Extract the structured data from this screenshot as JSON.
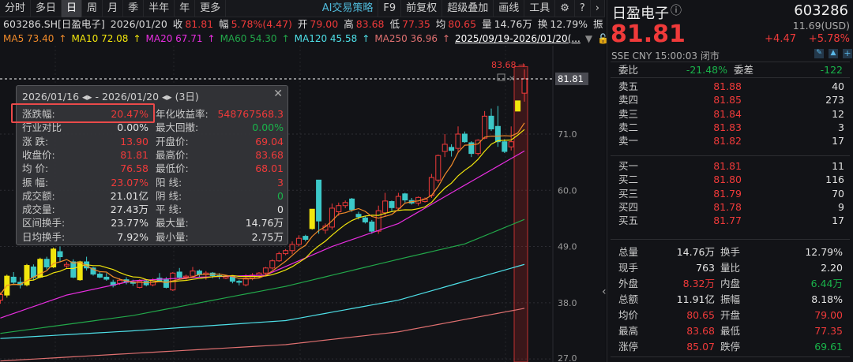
{
  "toolbar": {
    "periods": [
      "分时",
      "多日",
      "日",
      "周",
      "月",
      "季",
      "半年",
      "年",
      "更多"
    ],
    "active": "日",
    "tools": [
      "AI交易策略",
      "F9",
      "前复权",
      "超级叠加",
      "画线",
      "工具"
    ],
    "icons": [
      "gear-icon",
      "help-icon",
      "chevron-right-icon"
    ]
  },
  "info": {
    "code": "603286.SH[日盈电子]",
    "date": "2026/01/20",
    "close_label": "收",
    "close": "81.81",
    "chg_label": "幅",
    "chg": "5.78%(4.47)",
    "open_label": "开",
    "open": "79.00",
    "high_label": "高",
    "high": "83.68",
    "low_label": "低",
    "low": "77.35",
    "avg_label": "均",
    "avg": "80.65",
    "vol_label": "量",
    "vol": "14.76万",
    "turn_label": "换",
    "turn": "12.79%",
    "amp_label": "振"
  },
  "ma_legend": [
    {
      "label": "MA5 73.40",
      "color": "#f08a2a"
    },
    {
      "label": "MA10 72.08",
      "color": "#f2e60c"
    },
    {
      "label": "MA20 67.71",
      "color": "#e82ee0"
    },
    {
      "label": "MA60 54.30",
      "color": "#22a84a"
    },
    {
      "label": "MA120 45.58",
      "color": "#4ee0e8"
    },
    {
      "label": "MA250 36.96",
      "color": "#e07070"
    }
  ],
  "range_label": "2025/09/19-2026/01/20(...",
  "popup": {
    "header": "2026/01/16 ◂▸ - 2026/01/20 ◂▸    (3日)",
    "left": [
      {
        "k": "涨跌幅:",
        "v": "20.47%",
        "c": "red"
      },
      {
        "k": "行业对比",
        "v": "0.00%",
        "c": "wht"
      },
      {
        "k": "涨  跌:",
        "v": "13.90",
        "c": "red"
      },
      {
        "k": "收盘价:",
        "v": "81.81",
        "c": "red"
      },
      {
        "k": "均  价:",
        "v": "76.58",
        "c": "red"
      },
      {
        "k": "振  幅:",
        "v": "23.07%",
        "c": "red"
      },
      {
        "k": "成交额:",
        "v": "21.01亿",
        "c": "wht"
      },
      {
        "k": "成交量:",
        "v": "27.43万",
        "c": "wht"
      },
      {
        "k": "区间换手:",
        "v": "23.77%",
        "c": "wht"
      },
      {
        "k": "日均换手:",
        "v": "7.92%",
        "c": "wht"
      }
    ],
    "right": [
      {
        "k": "年化收益率:",
        "v": "548767568.3",
        "c": "red"
      },
      {
        "k": "最大回撤:",
        "v": "0.00%",
        "c": "grn"
      },
      {
        "k": "开盘价:",
        "v": "69.04",
        "c": "red"
      },
      {
        "k": "最高价:",
        "v": "83.68",
        "c": "red"
      },
      {
        "k": "最低价:",
        "v": "68.01",
        "c": "red"
      },
      {
        "k": "阳  线:",
        "v": "3",
        "c": "red"
      },
      {
        "k": "阴  线:",
        "v": "0",
        "c": "grn"
      },
      {
        "k": "平  线:",
        "v": "0",
        "c": "wht"
      },
      {
        "k": "最大量:",
        "v": "14.76万",
        "c": "wht"
      },
      {
        "k": "最小量:",
        "v": "2.75万",
        "c": "wht"
      }
    ]
  },
  "chart_data": {
    "type": "candlestick",
    "y_ticks": [
      "71.0",
      "60.0",
      "49.0",
      "38.0",
      "27.0"
    ],
    "ylim": [
      27,
      83.7
    ],
    "last_price_label": "81.81",
    "high_marker": "83.68",
    "colors": {
      "up": "#f03a3a",
      "down": "#3cc8c8",
      "limit": "#f2e60c"
    },
    "candles_ohlc": [
      [
        38.5,
        40,
        37.8,
        39.6,
        "u"
      ],
      [
        39.5,
        43.5,
        39,
        43.2,
        "y"
      ],
      [
        43,
        44,
        41.5,
        42,
        "d"
      ],
      [
        42,
        43,
        40.8,
        41.5,
        "d"
      ],
      [
        41.5,
        45.6,
        41.2,
        45.3,
        "y"
      ],
      [
        45,
        45.5,
        42.5,
        43,
        "d"
      ],
      [
        43,
        46.8,
        42.8,
        46.5,
        "y"
      ],
      [
        46.5,
        47,
        44.5,
        45,
        "d"
      ],
      [
        45,
        48.8,
        44.8,
        48.5,
        "y"
      ],
      [
        48,
        49,
        46,
        47,
        "d"
      ],
      [
        45.5,
        46,
        44.8,
        45.2,
        "u"
      ],
      [
        46,
        46.5,
        42.8,
        43,
        "d"
      ],
      [
        42.5,
        46.2,
        42.3,
        46,
        "y"
      ],
      [
        46,
        47,
        44.3,
        44.8,
        "d"
      ],
      [
        44.8,
        45,
        43.3,
        43.6,
        "d"
      ],
      [
        43.6,
        44,
        42.8,
        43,
        "d"
      ],
      [
        43,
        43.8,
        42.3,
        42.6,
        "d"
      ],
      [
        42,
        42.5,
        41,
        41.4,
        "d"
      ],
      [
        41.8,
        42.8,
        41.5,
        42.4,
        "u"
      ],
      [
        42.5,
        43,
        41.6,
        42,
        "d"
      ],
      [
        42,
        42.5,
        41.3,
        41.8,
        "d"
      ],
      [
        41,
        42.6,
        40.8,
        42.2,
        "u"
      ],
      [
        42.2,
        42.6,
        41.2,
        41.5,
        "d"
      ],
      [
        41.5,
        42.8,
        41.2,
        42.3,
        "u"
      ],
      [
        42.3,
        43.8,
        42,
        42.8,
        "d"
      ],
      [
        42.5,
        43,
        40.8,
        41,
        "d"
      ],
      [
        40.5,
        44,
        40.3,
        43.8,
        "u"
      ],
      [
        44,
        44.8,
        42.6,
        43,
        "d"
      ],
      [
        43,
        43.5,
        42.5,
        43.2,
        "u"
      ],
      [
        43.2,
        45,
        43,
        44.2,
        "u"
      ],
      [
        44.2,
        44.5,
        43,
        43.5,
        "d"
      ],
      [
        43.5,
        44.2,
        42.5,
        43.8,
        "u"
      ],
      [
        43.8,
        44,
        42.8,
        43.3,
        "d"
      ],
      [
        43.3,
        43.8,
        42.6,
        43.2,
        "d"
      ],
      [
        42.8,
        43.4,
        42.6,
        43.1,
        "u"
      ],
      [
        43.1,
        43.3,
        41.8,
        42.2,
        "d"
      ],
      [
        42.2,
        42.5,
        41.4,
        42,
        "d"
      ],
      [
        41.5,
        43.6,
        41.2,
        42.8,
        "u"
      ],
      [
        42.8,
        43.8,
        42.4,
        43.4,
        "u"
      ],
      [
        43.4,
        44,
        42.8,
        43.8,
        "u"
      ],
      [
        43.8,
        45,
        43.5,
        44.8,
        "u"
      ],
      [
        44.8,
        46.5,
        44.5,
        46.2,
        "u"
      ],
      [
        46.2,
        48,
        46,
        47.6,
        "u"
      ],
      [
        47.6,
        48.5,
        47.3,
        48.2,
        "u"
      ],
      [
        48.2,
        50,
        47.5,
        49.4,
        "u"
      ],
      [
        49.4,
        51.2,
        49,
        50.6,
        "u"
      ],
      [
        51,
        51.3,
        50,
        50.4,
        "d"
      ],
      [
        52.5,
        56.3,
        52.3,
        56.3,
        "y"
      ],
      [
        62,
        62,
        51.5,
        54,
        "d"
      ],
      [
        52.2,
        53.5,
        51.5,
        53,
        "u"
      ],
      [
        52.8,
        57.4,
        52.3,
        56.5,
        "u"
      ],
      [
        55.8,
        57.6,
        55,
        57,
        "u"
      ],
      [
        57,
        58,
        56.5,
        57.6,
        "u"
      ],
      [
        58.3,
        58.5,
        55.8,
        56.2,
        "d"
      ],
      [
        55.3,
        55.8,
        54.3,
        54.8,
        "d"
      ],
      [
        54.6,
        55,
        53.5,
        53.8,
        "d"
      ],
      [
        53.8,
        54.2,
        51.5,
        52,
        "d"
      ],
      [
        52,
        57,
        51.5,
        56,
        "u"
      ],
      [
        55.6,
        59.5,
        55,
        57.9,
        "u"
      ],
      [
        57.8,
        58,
        56,
        56.6,
        "d"
      ],
      [
        56.5,
        59.5,
        56,
        58.8,
        "u"
      ],
      [
        59.3,
        59.5,
        57.6,
        58.1,
        "d"
      ],
      [
        58,
        58.5,
        57.2,
        57.5,
        "d"
      ],
      [
        57.5,
        58.8,
        57,
        58.6,
        "u"
      ],
      [
        57.8,
        58.6,
        57.6,
        58.3,
        "u"
      ],
      [
        59,
        63.2,
        58.5,
        62.5,
        "u"
      ],
      [
        62,
        67,
        61.5,
        66.8,
        "u"
      ],
      [
        67.6,
        71,
        66.5,
        69,
        "u"
      ],
      [
        68.4,
        69,
        66.6,
        67.8,
        "d"
      ],
      [
        68.2,
        72.5,
        67.5,
        71,
        "u"
      ],
      [
        71,
        71.5,
        69.3,
        69.5,
        "d"
      ],
      [
        69.3,
        69.6,
        66.5,
        67.2,
        "d"
      ],
      [
        67.2,
        70,
        66.8,
        69.8,
        "u"
      ],
      [
        70.2,
        75.5,
        70,
        74.5,
        "u"
      ],
      [
        74.5,
        76,
        71.6,
        72,
        "d"
      ],
      [
        72.5,
        76.5,
        68.5,
        69.5,
        "d"
      ],
      [
        69.5,
        70,
        67.3,
        67.6,
        "d"
      ],
      [
        68.5,
        72.5,
        67.8,
        69.5,
        "u"
      ],
      [
        75.5,
        77.5,
        75.5,
        77.5,
        "y"
      ],
      [
        79,
        83.68,
        77.35,
        81.81,
        "u"
      ]
    ],
    "ma_series": {
      "MA20": [
        [
          0,
          35
        ],
        [
          10,
          39.5
        ],
        [
          20,
          42.3
        ],
        [
          30,
          43
        ],
        [
          40,
          43.4
        ],
        [
          50,
          49
        ],
        [
          60,
          53.5
        ],
        [
          70,
          61
        ],
        [
          79,
          67.7
        ]
      ],
      "MA60": [
        [
          0,
          32
        ],
        [
          20,
          35.5
        ],
        [
          43,
          41.2
        ],
        [
          60,
          46.5
        ],
        [
          70,
          49.5
        ],
        [
          79,
          54.3
        ]
      ],
      "MA120": [
        [
          0,
          31
        ],
        [
          20,
          32.5
        ],
        [
          43,
          34.5
        ],
        [
          60,
          38.5
        ],
        [
          79,
          45.5
        ]
      ],
      "MA250": [
        [
          0,
          26.6
        ],
        [
          43,
          29.8
        ],
        [
          60,
          32.3
        ],
        [
          79,
          36.9
        ]
      ]
    }
  },
  "quote": {
    "name": "日盈电子",
    "code": "603286",
    "price": "81.81",
    "usd": "11.69(USD)",
    "chg": "+4.47",
    "pct": "+5.78%",
    "exchange": "SSE",
    "currency": "CNY",
    "time": "15:00:03",
    "status": "闭市"
  },
  "orderbook": {
    "wb_label": "委比",
    "wb": "-21.48%",
    "wc_label": "委差",
    "wc": "-122",
    "sells": [
      {
        "l": "卖五",
        "p": "81.88",
        "q": "40"
      },
      {
        "l": "卖四",
        "p": "81.85",
        "q": "273"
      },
      {
        "l": "卖三",
        "p": "81.84",
        "q": "12"
      },
      {
        "l": "卖二",
        "p": "81.83",
        "q": "3"
      },
      {
        "l": "卖一",
        "p": "81.82",
        "q": "17"
      }
    ],
    "buys": [
      {
        "l": "买一",
        "p": "81.81",
        "q": "11"
      },
      {
        "l": "买二",
        "p": "81.80",
        "q": "116"
      },
      {
        "l": "买三",
        "p": "81.79",
        "q": "70"
      },
      {
        "l": "买四",
        "p": "81.78",
        "q": "9"
      },
      {
        "l": "买五",
        "p": "81.77",
        "q": "17"
      }
    ]
  },
  "stats": [
    {
      "k1": "总量",
      "v1": "14.76万",
      "c1": "wht",
      "k2": "换手",
      "v2": "12.79%",
      "c2": "wht"
    },
    {
      "k1": "现手",
      "v1": "763",
      "c1": "wht",
      "k2": "量比",
      "v2": "2.20",
      "c2": "wht"
    },
    {
      "k1": "外盘",
      "v1": "8.32万",
      "c1": "red",
      "k2": "内盘",
      "v2": "6.44万",
      "c2": "grn"
    },
    {
      "k1": "总额",
      "v1": "11.91亿",
      "c1": "wht",
      "k2": "振幅",
      "v2": "8.18%",
      "c2": "wht"
    },
    {
      "k1": "均价",
      "v1": "80.65",
      "c1": "red",
      "k2": "开盘",
      "v2": "79.00",
      "c2": "red"
    },
    {
      "k1": "最高",
      "v1": "83.68",
      "c1": "red",
      "k2": "最低",
      "v2": "77.35",
      "c2": "red"
    },
    {
      "k1": "涨停",
      "v1": "85.07",
      "c1": "red",
      "k2": "跌停",
      "v2": "69.61",
      "c2": "grn"
    }
  ]
}
